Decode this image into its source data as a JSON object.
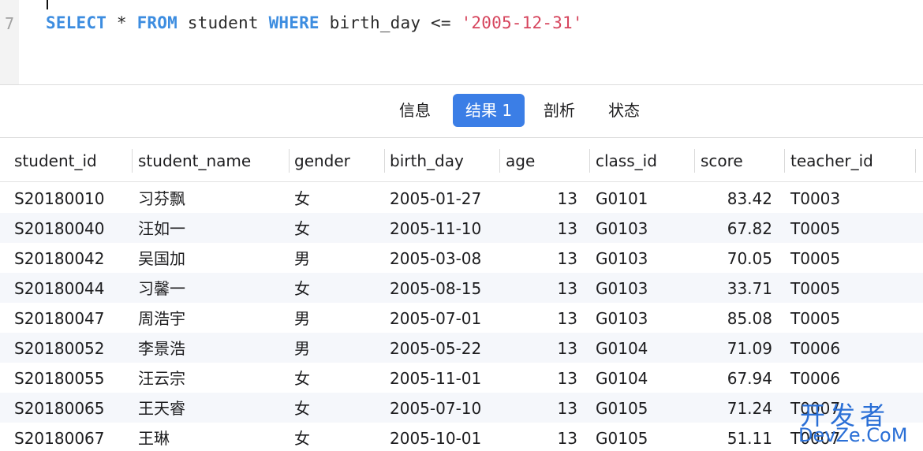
{
  "editor": {
    "line_number": "7",
    "sql": {
      "kw_select": "SELECT",
      "star": " * ",
      "kw_from": "FROM",
      "table": " student ",
      "kw_where": "WHERE",
      "condition": " birth_day <= ",
      "literal": "'2005-12-31'"
    }
  },
  "tabs": [
    {
      "label": "信息",
      "active": false
    },
    {
      "label": "结果 1",
      "active": true
    },
    {
      "label": "剖析",
      "active": false
    },
    {
      "label": "状态",
      "active": false
    }
  ],
  "grid": {
    "columns": [
      "student_id",
      "student_name",
      "gender",
      "birth_day",
      "age",
      "class_id",
      "score",
      "teacher_id"
    ],
    "rows": [
      [
        "S20180010",
        "习芬飘",
        "女",
        "2005-01-27",
        "13",
        "G0101",
        "83.42",
        "T0003"
      ],
      [
        "S20180040",
        "汪如一",
        "女",
        "2005-11-10",
        "13",
        "G0103",
        "67.82",
        "T0005"
      ],
      [
        "S20180042",
        "吴国加",
        "男",
        "2005-03-08",
        "13",
        "G0103",
        "70.05",
        "T0005"
      ],
      [
        "S20180044",
        "习馨一",
        "女",
        "2005-08-15",
        "13",
        "G0103",
        "33.71",
        "T0005"
      ],
      [
        "S20180047",
        "周浩宇",
        "男",
        "2005-07-01",
        "13",
        "G0103",
        "85.08",
        "T0005"
      ],
      [
        "S20180052",
        "李景浩",
        "男",
        "2005-05-22",
        "13",
        "G0104",
        "71.09",
        "T0006"
      ],
      [
        "S20180055",
        "汪云宗",
        "女",
        "2005-11-01",
        "13",
        "G0104",
        "67.94",
        "T0006"
      ],
      [
        "S20180065",
        "王天睿",
        "女",
        "2005-07-10",
        "13",
        "G0105",
        "71.24",
        "T0007"
      ],
      [
        "S20180067",
        "王琳",
        "女",
        "2005-10-01",
        "13",
        "G0105",
        "51.11",
        "T0007"
      ]
    ]
  },
  "watermark": {
    "top": "开发者",
    "bottom": "DevZe.CoM"
  },
  "colors": {
    "keyword": "#3d8de0",
    "string": "#d6455d",
    "active_tab": "#3b7ee6",
    "watermark": "#2a6fd6"
  }
}
